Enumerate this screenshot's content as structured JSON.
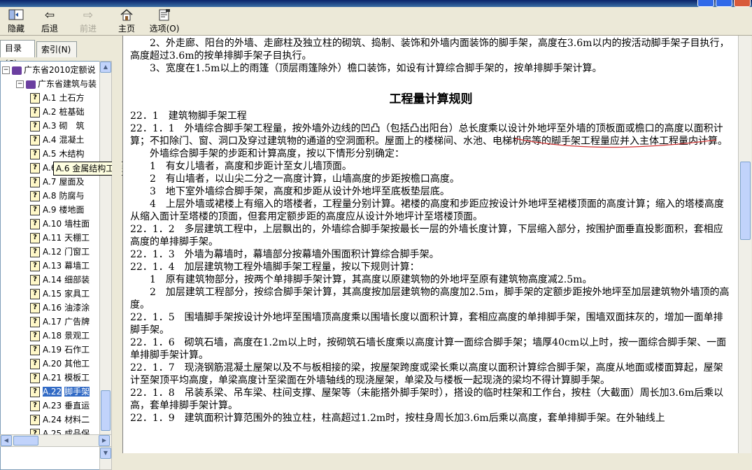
{
  "toolbar": {
    "hide": "隐藏",
    "back": "后退",
    "forward": "前进",
    "home": "主页",
    "options": "选项(O)"
  },
  "tabs": {
    "contents": "目录(C)",
    "index": "索引(N)"
  },
  "tree": {
    "root": "广东省2010定额说",
    "child": "广东省建筑与装",
    "items": [
      {
        "code": "A.1",
        "label": "土石方"
      },
      {
        "code": "A.2",
        "label": "桩基础"
      },
      {
        "code": "A.3",
        "label": "砌　筑"
      },
      {
        "code": "A.4",
        "label": "混凝土"
      },
      {
        "code": "A.5",
        "label": "木结构"
      },
      {
        "code": "A.6",
        "label": "金属结"
      },
      {
        "code": "A.7",
        "label": "屋面及"
      },
      {
        "code": "A.8",
        "label": "防腐与"
      },
      {
        "code": "A.9",
        "label": "楼地面"
      },
      {
        "code": "A.10",
        "label": "墙柱面"
      },
      {
        "code": "A.11",
        "label": "天棚工"
      },
      {
        "code": "A.12",
        "label": "门窗工"
      },
      {
        "code": "A.13",
        "label": "幕墙工"
      },
      {
        "code": "A.14",
        "label": "细部装"
      },
      {
        "code": "A.15",
        "label": "家具工"
      },
      {
        "code": "A.16",
        "label": "油漆涂"
      },
      {
        "code": "A.17",
        "label": "广告牌"
      },
      {
        "code": "A.18",
        "label": "景观工"
      },
      {
        "code": "A.19",
        "label": "石作工"
      },
      {
        "code": "A.20",
        "label": "其他工"
      },
      {
        "code": "A.21",
        "label": "模板工"
      },
      {
        "code": "A.22",
        "label": "脚手架"
      },
      {
        "code": "A.23",
        "label": "垂直运"
      },
      {
        "code": "A.24",
        "label": "材料二"
      },
      {
        "code": "A.25",
        "label": "成品保"
      }
    ],
    "tooltip": "A.6 金属结构工程"
  },
  "doc": {
    "paras_top": [
      "　　2、外走廊、阳台的外墙、走廊柱及独立柱的砌筑、捣制、装饰和外墙内面装饰的脚手架，高度在3.6m以内的按活动脚手架子目执行，高度超过3.6m的按单排脚手架子目执行。",
      "　　3、宽度在1.5m以上的雨篷（顶层雨篷除外）檐口装饰，如设有计算综合脚手架的，按单排脚手架计算。"
    ],
    "heading": "工程量计算规则",
    "paras": [
      "22．1　建筑物脚手架工程",
      "22．1．1　外墙综合脚手架工程量，按外墙外边线的凹凸（包括凸出阳台）总长度乘以设计外地坪至外墙的顶板面或檐口的高度以面积计算；不扣除门、窗、洞口及穿过建筑物的通道的空洞面积。屋面上的楼梯间、水池、电梯机房等的脚手架工程量应并入主体工程量内计算。",
      "　　外墙综合脚手架的步距和计算高度，按以下情形分别确定：",
      "　　1　有女儿墙者，高度和步距计至女儿墙顶面。",
      "　　2　有山墙者，以山尖二分之一高度计算，山墙高度的步距按檐口高度。",
      "　　3　地下室外墙综合脚手架，高度和步距从设计外地坪至底板垫层底。",
      "　　4　上层外墙或裙楼上有缩入的塔楼者，工程量分别计算。裙楼的高度和步距应按设计外地坪至裙楼顶面的高度计算；缩入的塔楼高度从缩入面计至塔楼的顶面，但套用定额步距的高度应从设计外地坪计至塔楼顶面。",
      "22．1．2　多层建筑工程中，上层飘出的，外墙综合脚手架按最长一层的外墙长度计算，下层缩入部分，按围护面垂直投影面积，套相应高度的单排脚手架。",
      "22．1．3　外墙为幕墙时，幕墙部分按幕墙外围面积计算综合脚手架。",
      "22．1．4　加层建筑物工程外墙脚手架工程量，按以下规则计算：",
      "　　1　原有建筑物部分，按两个单排脚手架计算，其高度以原建筑物的外地坪至原有建筑物高度减2.5m。",
      "　　2　加层建筑工程部分，按综合脚手架计算，其高度按加层建筑物的高度加2.5m，脚手架的定额步距按外地坪至加层建筑物外墙顶的高度。",
      "22．1．5　围墙脚手架按设计外地坪至围墙顶高度乘以围墙长度以面积计算，套相应高度的单排脚手架，围墙双面抹灰的，增加一面单排脚手架。",
      "22．1．6　砌筑石墙，高度在1.2m以上时，按砌筑石墙长度乘以高度计算一面综合脚手架；墙厚40cm以上时，按一面综合脚手架、一面单排脚手架计算。",
      "22．1．7　现浇钢筋混凝土屋架以及不与板相接的梁，按屋架跨度或梁长乘以高度以面积计算综合脚手架，高度从地面或楼面算起，屋架计至架顶平均高度，单梁高度计至梁面在外墙轴线的现浇屋架，单梁及与楼板一起现浇的梁均不得计算脚手架。",
      "22．1．8　吊装系梁、吊车梁、柱间支撑、屋架等（未能搭外脚手架时），搭设的临时柱架和工作台，按柱（大截面）周长加3.6m后乘以高，套单排脚手架计算。",
      "22．1．9　建筑面积计算范围外的独立柱，柱高超过1.2m时，按柱身周长加3.6m后乘以高度，套单排脚手架。在外轴线上"
    ]
  }
}
